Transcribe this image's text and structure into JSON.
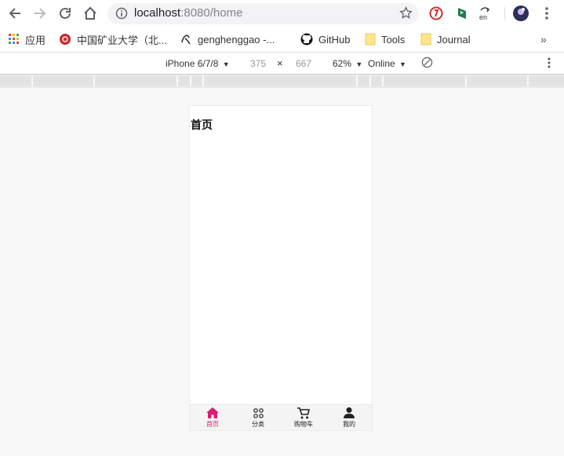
{
  "browser": {
    "url_host": "localhost",
    "url_rest": ":8080/home"
  },
  "bookmarks": [
    {
      "label": "应用",
      "icon": "apps-grid-icon"
    },
    {
      "label": "中国矿业大学（北...",
      "icon": "university-icon"
    },
    {
      "label": "genghenggao -...",
      "icon": "profile-icon"
    },
    {
      "label": "GitHub",
      "icon": "github-icon"
    },
    {
      "label": "Tools",
      "icon": "folder-icon"
    },
    {
      "label": "Journal",
      "icon": "folder-icon"
    }
  ],
  "devtools": {
    "device": "iPhone 6/7/8",
    "width": "375",
    "times": "×",
    "height": "667",
    "zoom": "62%",
    "network": "Online"
  },
  "app": {
    "page_title": "首页",
    "tabs": [
      {
        "label": "首页",
        "icon": "home-icon",
        "active": true
      },
      {
        "label": "分类",
        "icon": "category-grid-icon",
        "active": false
      },
      {
        "label": "购物车",
        "icon": "cart-icon",
        "active": false
      },
      {
        "label": "我的",
        "icon": "user-icon",
        "active": false
      }
    ],
    "active_color": "#d81e73"
  }
}
